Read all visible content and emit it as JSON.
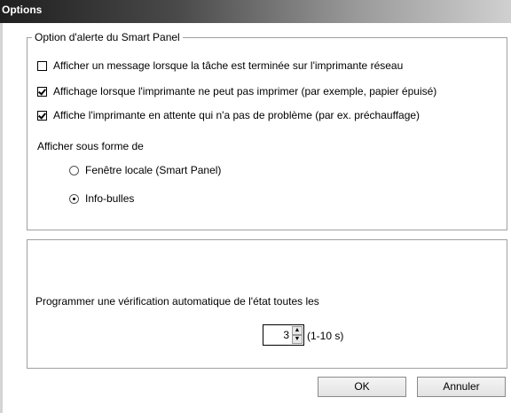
{
  "window": {
    "title": "Options"
  },
  "alert_group": {
    "legend": "Option d'alerte du Smart Panel",
    "options": [
      {
        "label": "Afficher un message lorsque la tâche est terminée sur l'imprimante réseau",
        "checked": false
      },
      {
        "label": "Affichage lorsque l'imprimante ne peut pas imprimer (par exemple, papier épuisé)",
        "checked": true
      },
      {
        "label": "Affiche l'imprimante en attente qui n'a pas de problème (par ex. préchauffage)",
        "checked": true
      }
    ],
    "display_as_label": "Afficher sous forme de",
    "display_modes": [
      {
        "label": "Fenêtre locale (Smart Panel)",
        "selected": false
      },
      {
        "label": "Info-bulles",
        "selected": true
      }
    ]
  },
  "schedule_group": {
    "label": "Programmer une vérification automatique de l'état toutes les",
    "interval_value": "3",
    "interval_range": "(1-10 s)"
  },
  "buttons": {
    "ok": "OK",
    "cancel": "Annuler"
  }
}
